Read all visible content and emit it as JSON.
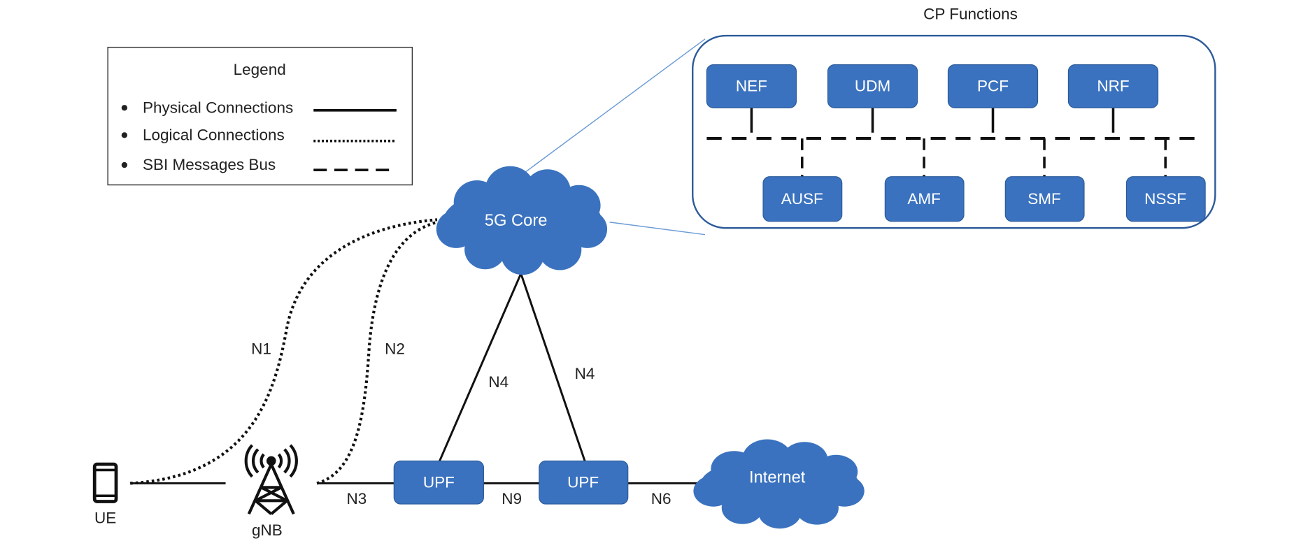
{
  "colors": {
    "function_box": "#3a72bf",
    "cloud": "#3a72bf",
    "container_border": "#2c5a99",
    "link_line": "#6b9bd6"
  },
  "legend": {
    "title": "Legend",
    "items": [
      {
        "label": "Physical Connections",
        "style": "solid"
      },
      {
        "label": "Logical Connections",
        "style": "dotted"
      },
      {
        "label": "SBI Messages Bus",
        "style": "dashed"
      }
    ]
  },
  "cp": {
    "title": "CP Functions",
    "top": [
      "NEF",
      "UDM",
      "PCF",
      "NRF"
    ],
    "bottom": [
      "AUSF",
      "AMF",
      "SMF",
      "NSSF"
    ]
  },
  "nodes": {
    "core": "5G Core",
    "internet": "Internet",
    "upf1": "UPF",
    "upf2": "UPF",
    "ue": "UE",
    "gnb": "gNB"
  },
  "interfaces": {
    "n1": "N1",
    "n2": "N2",
    "n3": "N3",
    "n4a": "N4",
    "n4b": "N4",
    "n6": "N6",
    "n9": "N9"
  }
}
